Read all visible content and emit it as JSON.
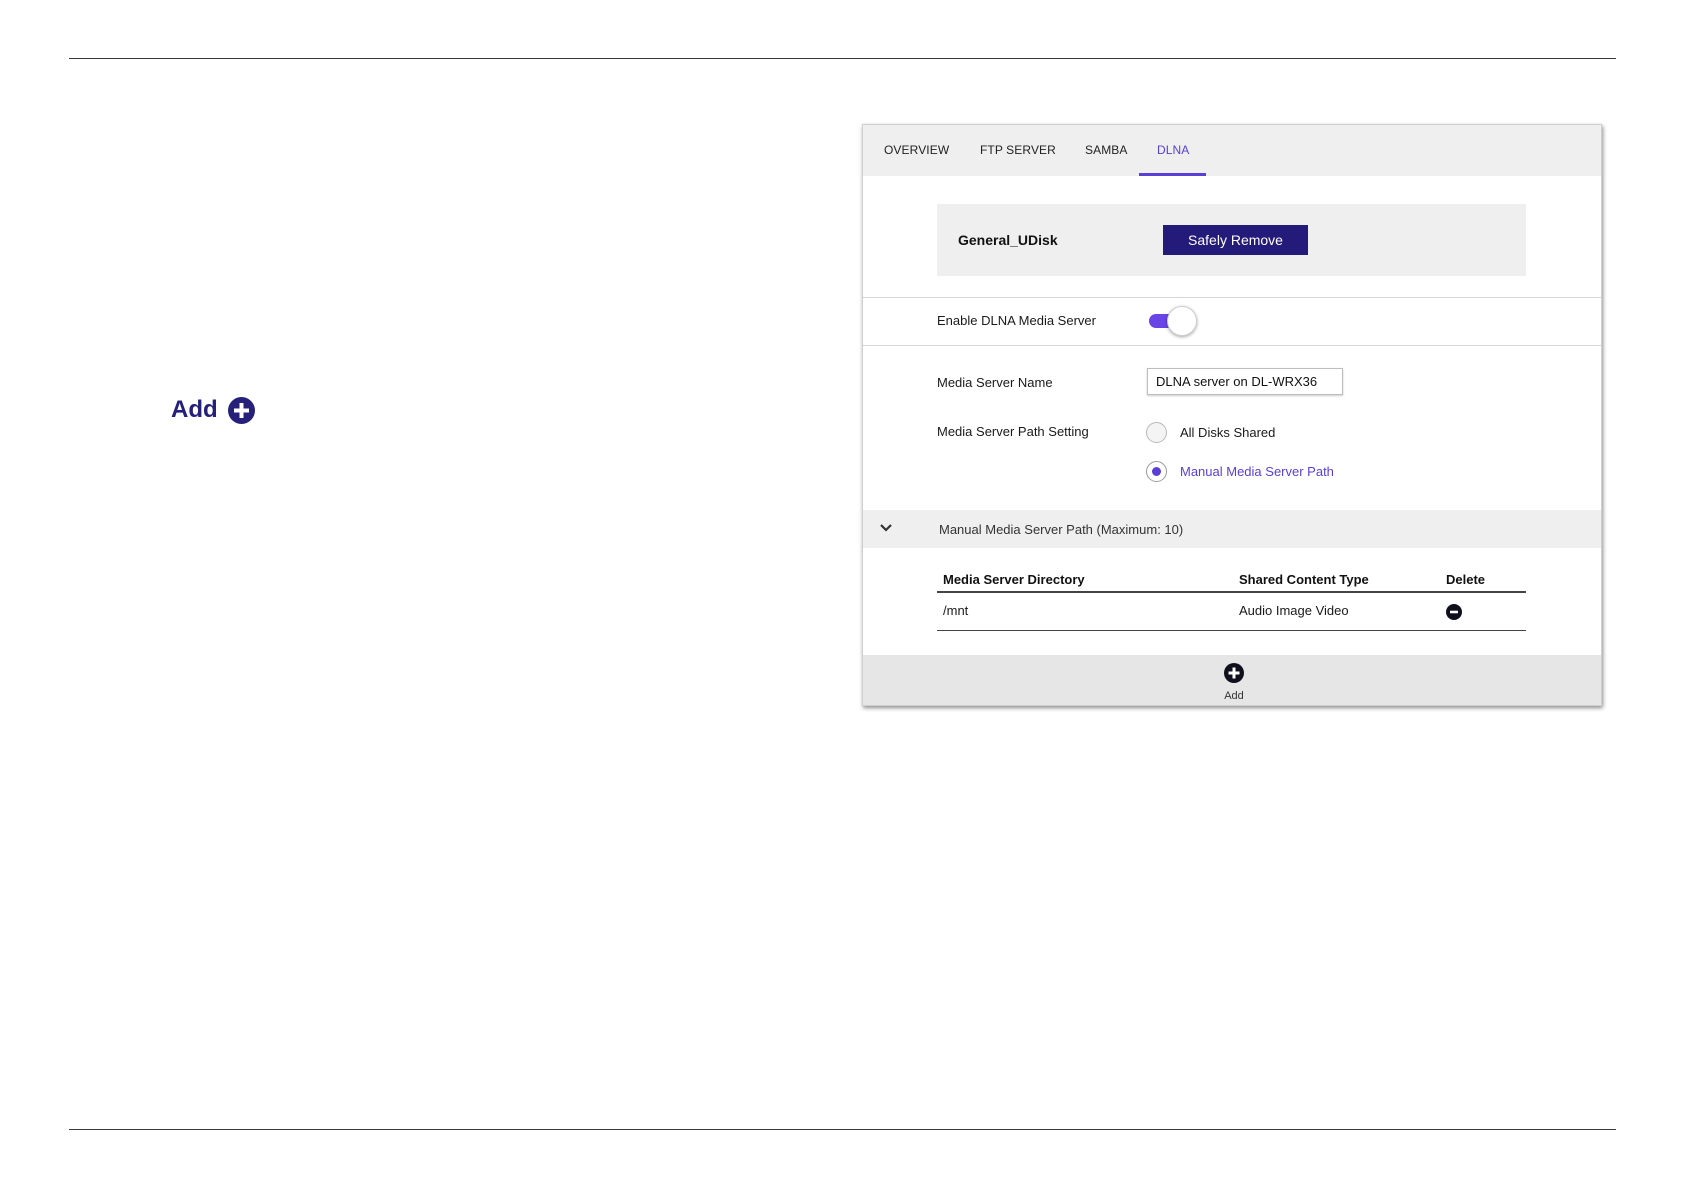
{
  "doc": {
    "add_label": "Add"
  },
  "tabs": [
    {
      "label": "OVERVIEW"
    },
    {
      "label": "FTP SERVER"
    },
    {
      "label": "SAMBA"
    },
    {
      "label": "DLNA"
    }
  ],
  "active_tab": "DLNA",
  "device": {
    "name": "General_UDisk",
    "remove_label": "Safely Remove"
  },
  "dlna": {
    "enable_label": "Enable DLNA Media Server",
    "enabled": true,
    "server_name_label": "Media Server Name",
    "server_name_value": "DLNA server on DL-WRX36",
    "path_setting_label": "Media Server Path Setting",
    "options": [
      {
        "label": "All Disks Shared",
        "selected": false
      },
      {
        "label": "Manual Media Server Path",
        "selected": true
      }
    ]
  },
  "manual_section": {
    "title": "Manual Media Server Path (Maximum: 10)",
    "columns": [
      "Media Server Directory",
      "Shared Content Type",
      "Delete"
    ],
    "rows": [
      {
        "directory": "/mnt",
        "content_type": "Audio Image Video"
      }
    ]
  },
  "footer": {
    "add_label": "Add"
  },
  "colors": {
    "accent": "#5a3fd6",
    "button": "#241a7a",
    "icon": "#26207a"
  }
}
